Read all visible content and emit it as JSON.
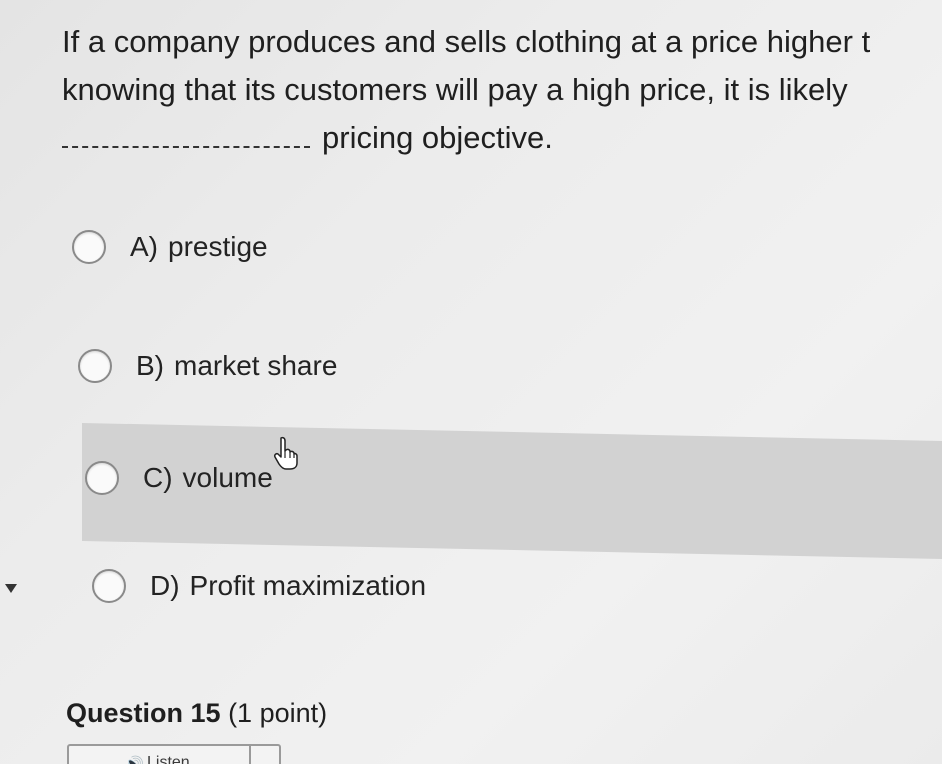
{
  "question": {
    "line1": "If a company produces and sells clothing at a price higher t",
    "line2": "knowing that its customers will pay a high price, it is likely",
    "line3_suffix": "pricing objective."
  },
  "options": [
    {
      "letter": "A)",
      "label": "prestige"
    },
    {
      "letter": "B)",
      "label": "market share"
    },
    {
      "letter": "C)",
      "label": "volume"
    },
    {
      "letter": "D)",
      "label": "Profit maximization"
    }
  ],
  "next_question": {
    "number": "Question 15",
    "points": "(1 point)"
  },
  "listen_button": {
    "label": "Listen",
    "icon": "speaker-icon"
  },
  "cursor_icon": "pointer-hand-icon"
}
